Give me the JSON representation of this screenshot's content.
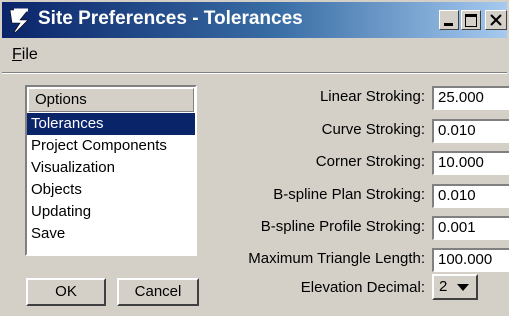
{
  "window": {
    "title": "Site Preferences - Tolerances",
    "icon": "bentley-b-icon"
  },
  "menu": {
    "file_label": "File"
  },
  "options": {
    "header": "Options",
    "items": [
      "Tolerances",
      "Project Components",
      "Visualization",
      "Objects",
      "Updating",
      "Save"
    ],
    "selected_index": 0
  },
  "fields": {
    "linear_stroking": {
      "label": "Linear Stroking:",
      "value": "25.000"
    },
    "curve_stroking": {
      "label": "Curve Stroking:",
      "value": "0.010"
    },
    "corner_stroking": {
      "label": "Corner Stroking:",
      "value": "10.000"
    },
    "bspline_plan_stroking": {
      "label": "B-spline Plan Stroking:",
      "value": "0.010"
    },
    "bspline_profile_stroking": {
      "label": "B-spline Profile Stroking:",
      "value": "0.001"
    },
    "max_triangle_length": {
      "label": "Maximum Triangle Length:",
      "value": "100.000"
    },
    "elevation_decimal": {
      "label": "Elevation Decimal:",
      "value": "2"
    }
  },
  "buttons": {
    "ok": "OK",
    "cancel": "Cancel"
  },
  "colors": {
    "title_bar_start": "#0a246a",
    "title_bar_end": "#a6caf0",
    "selection": "#0a246a",
    "face": "#d4d0c8"
  }
}
